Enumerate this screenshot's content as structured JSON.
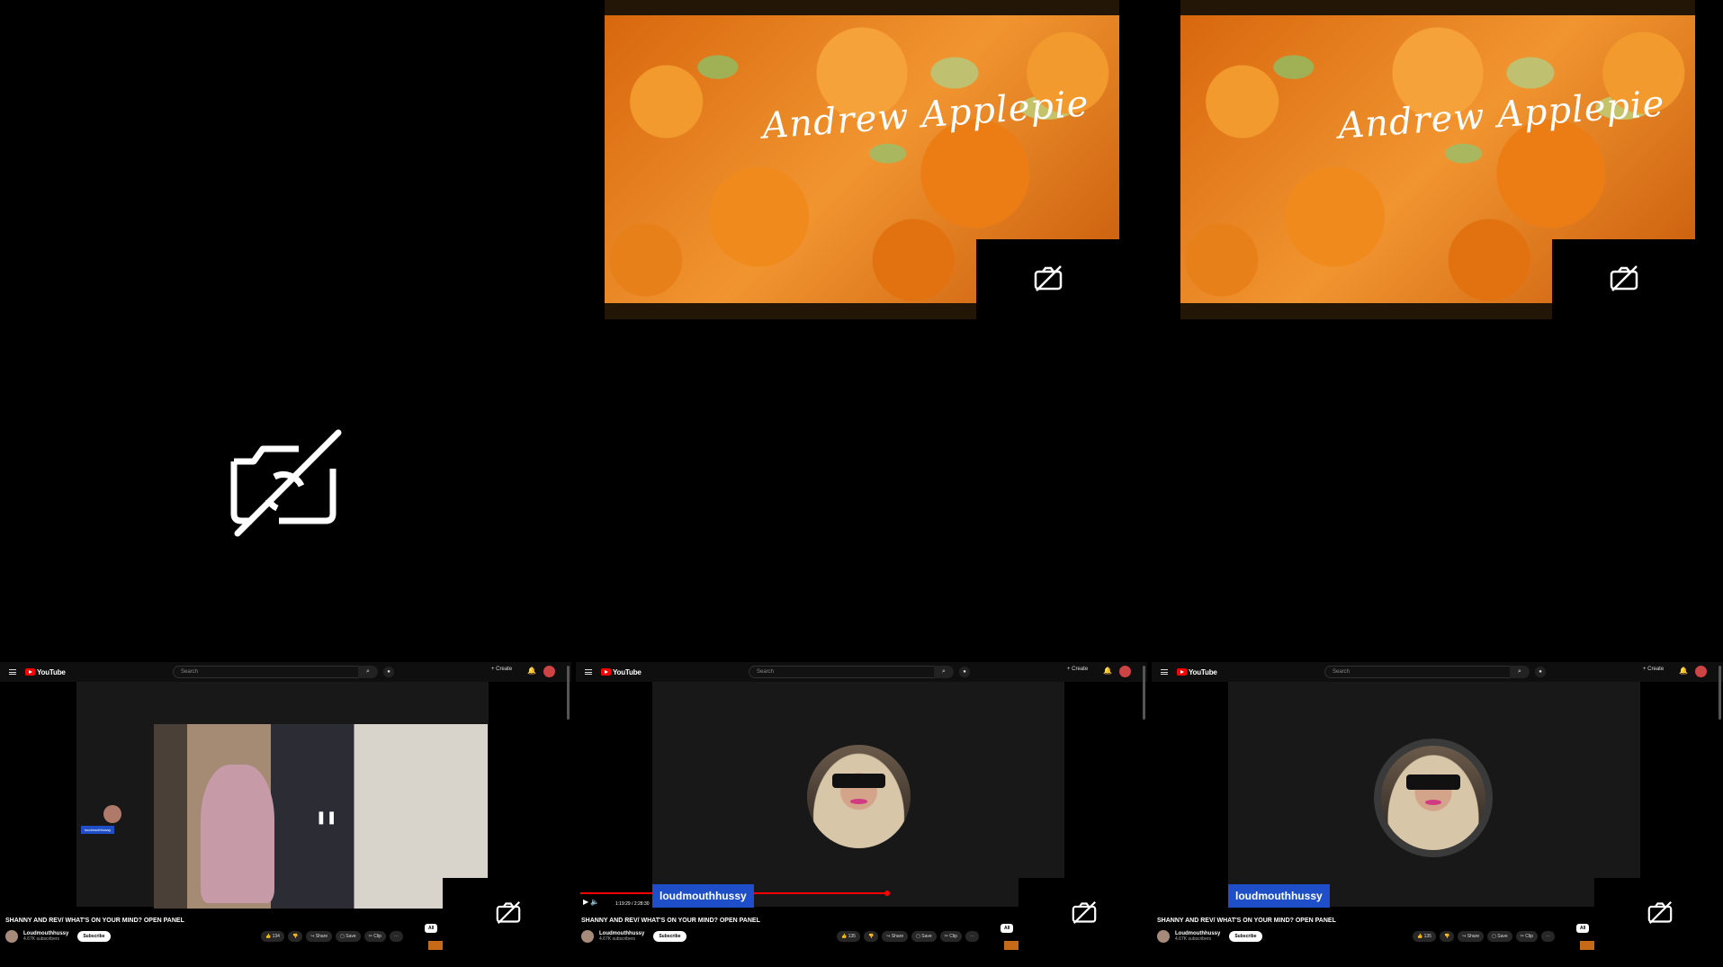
{
  "tiles": {
    "top_left": {
      "camera_off_icon": "camera-off-icon"
    },
    "orange_1": {
      "signature": "Andrew Applepie",
      "camera_off_icon": "camera-off-icon"
    },
    "orange_2": {
      "signature": "Andrew Applepie",
      "camera_off_icon": "camera-off-icon"
    }
  },
  "youtube": {
    "search_placeholder": "Search",
    "logo_text": "YouTube",
    "create_label": "+ Create",
    "video_title": "SHANNY AND REV/ WHAT'S ON YOUR MIND? OPEN PANEL",
    "channel_name": "Loudmouthhussy",
    "subscriber_count": "4.67K subscribers",
    "subscribe_label": "Subscribe",
    "share_label": "Share",
    "save_label": "Save",
    "clip_label": "Clip",
    "all_label": "All",
    "tile1": {
      "likes": "134",
      "name_tag": "loudmouthhussy"
    },
    "tile2": {
      "likes": "135",
      "name_badge": "loudmouthhussy",
      "time": "1:19:29 / 2:28:30"
    },
    "tile3": {
      "likes": "135",
      "name_badge": "loudmouthhussy"
    }
  }
}
